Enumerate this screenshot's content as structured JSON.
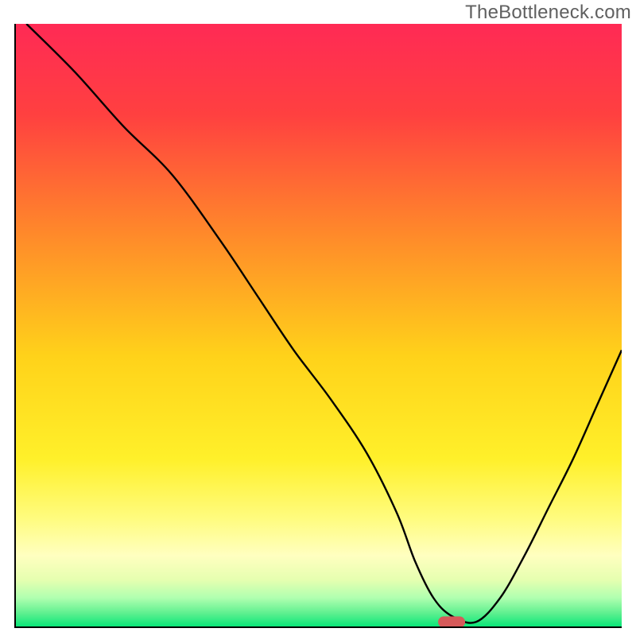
{
  "watermark": "TheBottleneck.com",
  "chart_data": {
    "type": "line",
    "title": "",
    "xlabel": "",
    "ylabel": "",
    "xlim": [
      0,
      100
    ],
    "ylim": [
      0,
      100
    ],
    "x": [
      2,
      10,
      18,
      26,
      34,
      40,
      46,
      52,
      58,
      63,
      66,
      69,
      72,
      76,
      80,
      84,
      88,
      92,
      96,
      100
    ],
    "y": [
      100,
      92,
      83,
      75,
      64,
      55,
      46,
      38,
      29,
      19,
      11,
      5,
      2,
      1,
      5,
      12,
      20,
      28,
      37,
      46
    ],
    "marker": {
      "x": 72,
      "y": 1
    },
    "gradient_stops": [
      {
        "offset": 0.0,
        "color": "#ff2a55"
      },
      {
        "offset": 0.15,
        "color": "#ff4040"
      },
      {
        "offset": 0.35,
        "color": "#ff8a2a"
      },
      {
        "offset": 0.55,
        "color": "#ffd21a"
      },
      {
        "offset": 0.72,
        "color": "#fff02a"
      },
      {
        "offset": 0.82,
        "color": "#fffc80"
      },
      {
        "offset": 0.88,
        "color": "#ffffc0"
      },
      {
        "offset": 0.92,
        "color": "#e6ffb0"
      },
      {
        "offset": 0.95,
        "color": "#b0ffb0"
      },
      {
        "offset": 0.975,
        "color": "#60f090"
      },
      {
        "offset": 1.0,
        "color": "#00e676"
      }
    ],
    "axis_color": "#000000",
    "line_color": "#000000",
    "marker_color": "#d65a5a"
  }
}
